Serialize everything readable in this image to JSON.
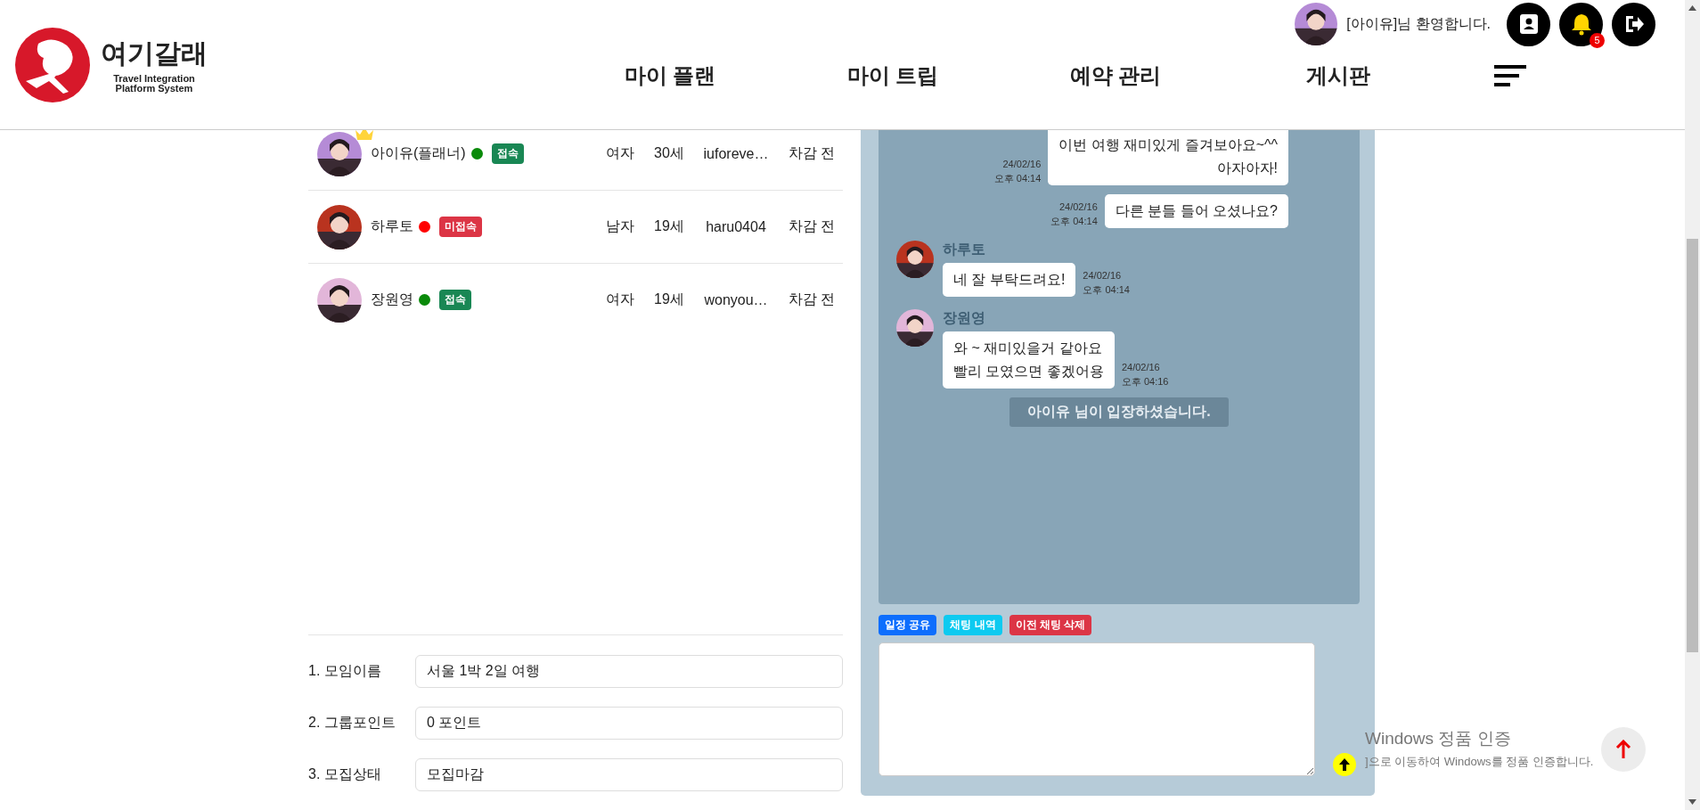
{
  "header": {
    "brand": {
      "name": "여기갈래",
      "subtitle": [
        "Travel Integration",
        "Platform System"
      ]
    },
    "nav": [
      {
        "label": "마이 플랜"
      },
      {
        "label": "마이 트립"
      },
      {
        "label": "예약 관리"
      },
      {
        "label": "게시판"
      }
    ],
    "welcome": "[아이유]님 환영합니다.",
    "notification_count": "5"
  },
  "members": [
    {
      "name": "아이유(플래너)",
      "leader": true,
      "online": true,
      "status_label": "접속",
      "gender": "여자",
      "age": "30세",
      "user_id": "iuforeve…",
      "state": "차감 전"
    },
    {
      "name": "하루토",
      "leader": false,
      "online": false,
      "status_label": "미접속",
      "gender": "남자",
      "age": "19세",
      "user_id": "haru0404",
      "state": "차감 전"
    },
    {
      "name": "장원영",
      "leader": false,
      "online": true,
      "status_label": "접속",
      "gender": "여자",
      "age": "19세",
      "user_id": "wonyou…",
      "state": "차감 전"
    }
  ],
  "form": [
    {
      "label": "1. 모임이름",
      "value": "서울 1박 2일 여행"
    },
    {
      "label": "2. 그룹포인트",
      "value": "0 포인트"
    },
    {
      "label": "3. 모집상태",
      "value": "모집마감"
    }
  ],
  "chat": {
    "messages": [
      {
        "kind": "mine",
        "lines": [
          "이번 여행 재미있게 즐겨보아요~^^",
          "아자아자!"
        ],
        "date": "24/02/16",
        "time": "오후 04:14"
      },
      {
        "kind": "mine",
        "lines": [
          "다른 분들 들어 오셨나요?"
        ],
        "date": "24/02/16",
        "time": "오후 04:14"
      },
      {
        "kind": "other",
        "sender": "하루토",
        "lines": [
          "네 잘 부탁드려요!"
        ],
        "date": "24/02/16",
        "time": "오후 04:14"
      },
      {
        "kind": "other",
        "sender": "장원영",
        "lines": [
          "와 ~ 재미있을거 같아요",
          "빨리 모였으면 좋겠어용"
        ],
        "date": "24/02/16",
        "time": "오후 04:16"
      },
      {
        "kind": "system",
        "lines": [
          "아이유 님이 입장하셨습니다."
        ]
      }
    ],
    "actions": [
      {
        "label": "일정 공유",
        "color": "#0d6efd"
      },
      {
        "label": "채팅 내역",
        "color": "#0dcaf0"
      },
      {
        "label": "이전 채팅 삭제",
        "color": "#dc3545"
      }
    ]
  },
  "os_notice": {
    "title": "Windows 정품 인증",
    "message": "]으로 이동하여 Windows를 정품 인증합니다."
  }
}
